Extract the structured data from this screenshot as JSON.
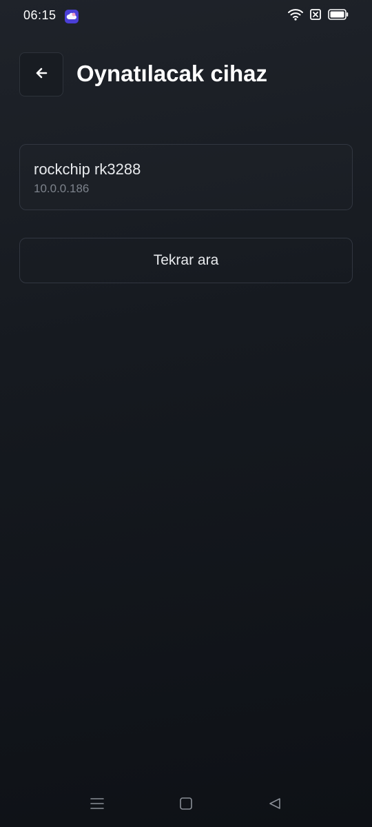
{
  "status_bar": {
    "time": "06:15"
  },
  "header": {
    "title": "Oynatılacak cihaz"
  },
  "devices": [
    {
      "name": "rockchip rk3288",
      "ip": "10.0.0.186"
    }
  ],
  "actions": {
    "rescan_label": "Tekrar ara"
  },
  "icons": {
    "back": "arrow-left-icon",
    "app_notification": "cloud-app-icon",
    "wifi": "wifi-icon",
    "sim": "no-sim-icon",
    "battery": "battery-icon",
    "nav_menu": "menu-icon",
    "nav_home": "home-icon",
    "nav_back": "back-triangle-icon"
  },
  "colors": {
    "background": "#161a20",
    "card_border": "#323741",
    "secondary_text": "#7d838c",
    "app_icon": "#4b3fd6"
  }
}
